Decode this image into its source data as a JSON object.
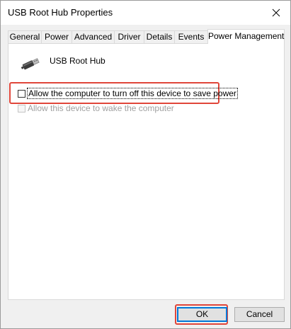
{
  "window": {
    "title": "USB Root Hub Properties"
  },
  "tabs": [
    {
      "label": "General",
      "active": false
    },
    {
      "label": "Power",
      "active": false
    },
    {
      "label": "Advanced",
      "active": false
    },
    {
      "label": "Driver",
      "active": false
    },
    {
      "label": "Details",
      "active": false
    },
    {
      "label": "Events",
      "active": false
    },
    {
      "label": "Power Management",
      "active": true
    }
  ],
  "device": {
    "name": "USB Root Hub",
    "icon": "usb-plug-icon"
  },
  "options": [
    {
      "label": "Allow the computer to turn off this device to save power",
      "checked": false,
      "enabled": true,
      "highlighted": true
    },
    {
      "label": "Allow this device to wake the computer",
      "checked": false,
      "enabled": false,
      "highlighted": false
    }
  ],
  "buttons": {
    "ok_label": "OK",
    "cancel_label": "Cancel"
  },
  "colors": {
    "highlight": "#e0463a",
    "focus_blue": "#0078d7"
  }
}
